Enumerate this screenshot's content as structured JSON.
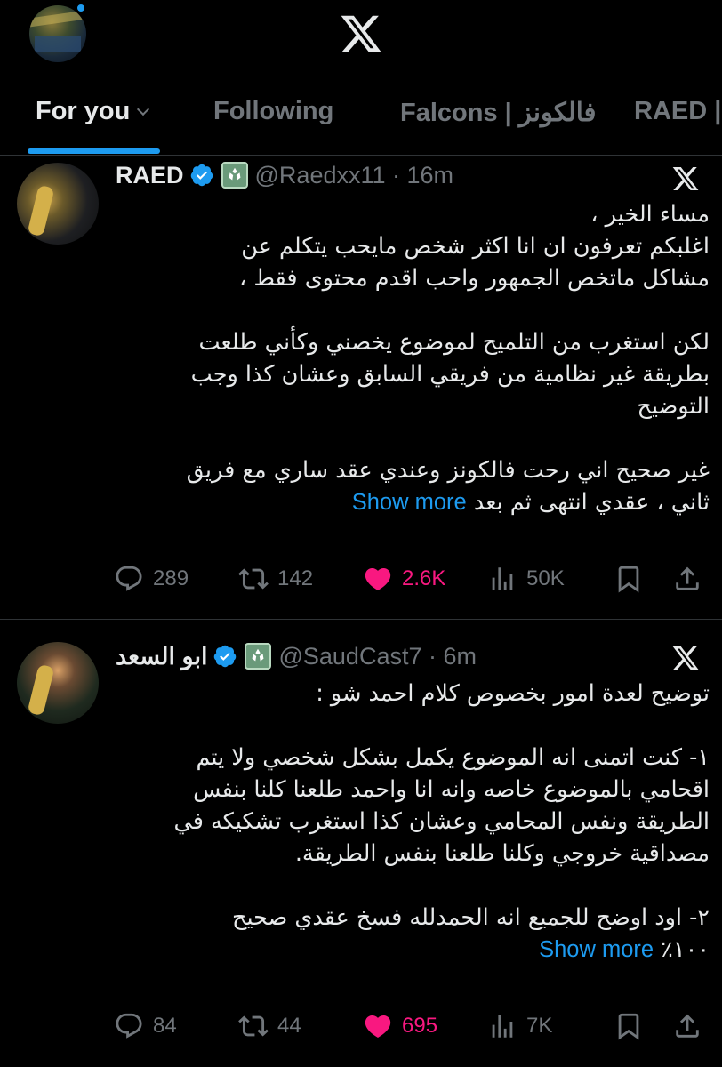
{
  "header": {
    "tabs": [
      {
        "label": "For you",
        "active": true
      },
      {
        "label": "Following"
      },
      {
        "label": "Falcons | فالكونز"
      },
      {
        "label": "RAED |"
      }
    ]
  },
  "tweets": [
    {
      "display_name": "RAED",
      "handle_time": "@Raedxx11 · 16m",
      "body_lines": [
        "مساء الخير ،",
        "اغلبكم تعرفون ان انا اكثر شخص مايحب يتكلم عن",
        "مشاكل ماتخص الجمهور واحب اقدم محتوى فقط ،",
        "",
        "لكن استغرب من التلميح لموضوع يخصني وكأني طلعت",
        "بطريقة غير نظامية من فريقي السابق وعشان كذا وجب",
        "التوضيح",
        "",
        "غير صحيح اني رحت فالكونز وعندي عقد ساري مع فريق"
      ],
      "last_line": "ثاني ، عقدي انتهى ثم بعد",
      "show_more": "Show more",
      "replies": "289",
      "reposts": "142",
      "likes": "2.6K",
      "views": "50K"
    },
    {
      "display_name": "ابو السعد",
      "handle_time": "@SaudCast7 · 6m",
      "body_lines": [
        "توضيح لعدة امور بخصوص كلام احمد شو :",
        "",
        "١- كنت اتمنى انه الموضوع يكمل بشكل شخصي ولا يتم",
        "اقحامي بالموضوع خاصه وانه انا واحمد طلعنا كلنا بنفس",
        "الطريقة ونفس المحامي وعشان كذا استغرب تشكيكه في",
        "مصداقية خروجي وكلنا طلعنا بنفس الطريقة.",
        "",
        "٢- اود اوضح للجميع انه الحمدلله فسخ عقدي صحيح"
      ],
      "last_line": "١٠٠٪",
      "show_more": "Show more",
      "replies": "84",
      "reposts": "44",
      "likes": "695",
      "views": "7K"
    }
  ],
  "colors": {
    "accent": "#1d9bf0",
    "like": "#f91880",
    "muted": "#71767b",
    "text": "#e7e9ea",
    "background": "#000000"
  },
  "icons": [
    "x-logo",
    "chevron-down-icon",
    "verified-badge-icon",
    "affiliate-badge-icon",
    "reply-icon",
    "repost-icon",
    "heart-icon",
    "views-icon",
    "bookmark-icon",
    "share-icon"
  ]
}
